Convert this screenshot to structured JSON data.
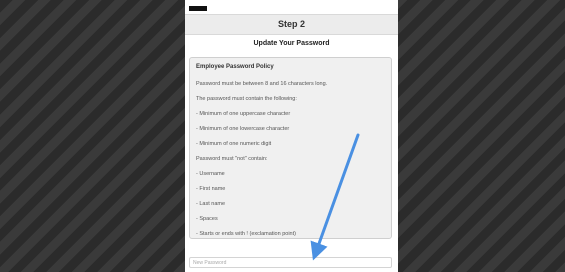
{
  "step": {
    "label": "Step 2"
  },
  "title": "Update Your Password",
  "policy": {
    "heading": "Employee Password Policy",
    "lines": [
      "Password must be between 8 and 16 characters long.",
      "The password must contain the following:",
      "- Minimum of one uppercase character",
      "- Minimum of one lowercase character",
      "- Minimum of one numeric digit",
      "Password must \"not\" contain:",
      "- Username",
      "- First name",
      "- Last name",
      "- Spaces",
      "- Starts or ends with ! (exclamation point)"
    ]
  },
  "password_field": {
    "placeholder": "New Password"
  },
  "annotation": {
    "arrow_color": "#4a90e2"
  }
}
